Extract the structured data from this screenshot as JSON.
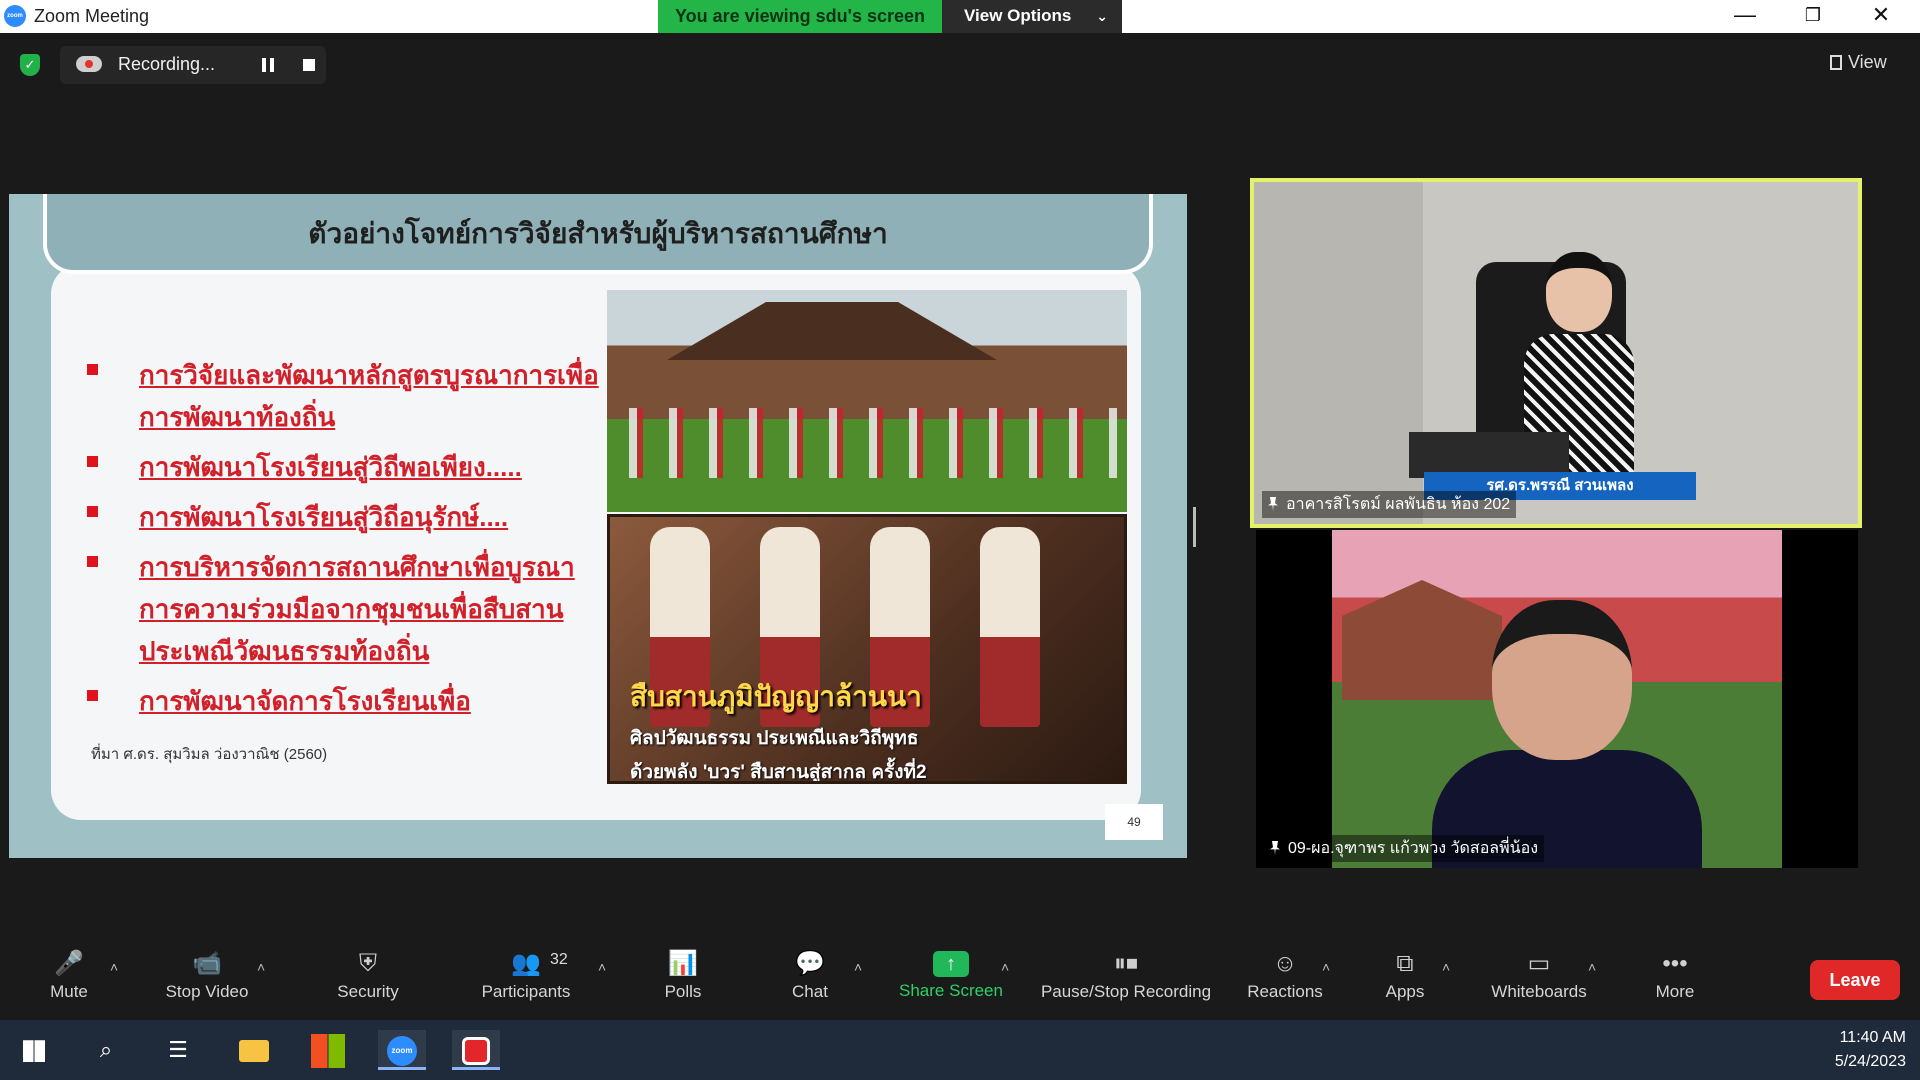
{
  "window": {
    "title": "Zoom Meeting",
    "logo_text": "zoom",
    "minimize": "—",
    "restore": "❐",
    "close": "✕"
  },
  "banner": {
    "viewing_text": "You are viewing sdu's screen",
    "view_options_label": "View Options",
    "view_options_caret": "⌄"
  },
  "recording": {
    "status_text": "Recording...",
    "security_check": "✓"
  },
  "view_button": {
    "label": "View"
  },
  "slide": {
    "title": "ตัวอย่างโจทย์การวิจัยสำหรับผู้บริหารสถานศึกษา",
    "bullets": [
      "การวิจัยและพัฒนาหลักสูตรบูรณาการเพื่อการพัฒนาท้องถิ่น",
      "การพัฒนาโรงเรียนสู่วิถีพอเพียง.....",
      "การพัฒนาโรงเรียนสู่วิถีอนุรักษ์....",
      "การบริหารจัดการสถานศึกษาเพื่อบูรณาการความร่วมมือจากชุมชนเพื่อสืบสานประเพณีวัฒนธรรมท้องถิ่น",
      "การพัฒนาจัดการโรงเรียนเพื่อ"
    ],
    "source": "ที่มา ศ.ดร. สุมวิมล ว่องวาณิช (2560)",
    "page_number": "49",
    "photo_caption_title": "สืบสานภูมิปัญญาล้านนา",
    "photo_caption_line1": "ศิลปวัฒนธรรม ประเพณีและวิถีพุทธ",
    "photo_caption_line2": "ด้วยพลัง 'บวร' สืบสานสู่สากล ครั้งที่2"
  },
  "participants_tiles": [
    {
      "label": "อาคารสิโรตม์ ผลพันธิน ห้อง 202",
      "overlay_name": "รศ.ดร.พรรณี สวนเพลง",
      "highlight_color": "#e6f16b"
    },
    {
      "label": "09-ผอ.จุฑาพร แก้วพวง วัดสอลพี่น้อง"
    }
  ],
  "toolbar": {
    "mute": {
      "label": "Mute",
      "icon": "microphone-icon"
    },
    "stop_video": {
      "label": "Stop Video",
      "icon": "video-camera-icon"
    },
    "security": {
      "label": "Security",
      "icon": "shield-icon"
    },
    "participants": {
      "label": "Participants",
      "count": "32",
      "icon": "people-icon"
    },
    "polls": {
      "label": "Polls",
      "icon": "bar-chart-icon"
    },
    "chat": {
      "label": "Chat",
      "icon": "chat-bubble-icon"
    },
    "share_screen": {
      "label": "Share Screen",
      "icon": "share-arrow-icon",
      "arrow": "↑"
    },
    "pause_stop_recording": {
      "label": "Pause/Stop Recording",
      "icon": "pause-stop-icon"
    },
    "reactions": {
      "label": "Reactions",
      "icon": "smiley-icon"
    },
    "apps": {
      "label": "Apps",
      "icon": "apps-icon"
    },
    "whiteboards": {
      "label": "Whiteboards",
      "icon": "whiteboard-icon"
    },
    "more": {
      "label": "More",
      "icon": "ellipsis-icon",
      "dots": "•••"
    },
    "leave": {
      "label": "Leave"
    },
    "caret": "˄",
    "accent_green": "#2ed066",
    "leave_color": "#e02828"
  },
  "taskbar": {
    "time": "11:40 AM",
    "date": "5/24/2023",
    "zoom_text": "zoom"
  }
}
